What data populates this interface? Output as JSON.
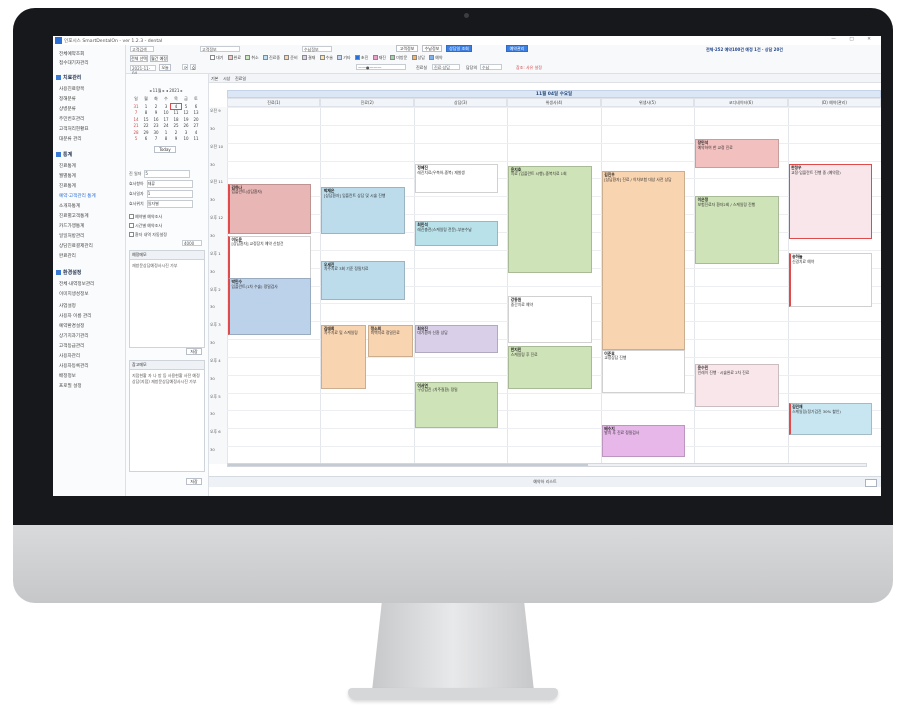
{
  "app": {
    "title": "인포시스 SmartDentalOn - ver 1.2.3 - dental",
    "window_buttons": "— □ ✕"
  },
  "nav": {
    "items_top": [
      "전체예약조회",
      "접수대기자관리"
    ],
    "section1": "치료관리",
    "section1_items": [
      "사용진료항목",
      "정해분류",
      "상병분류",
      "주민번호관리",
      "고객처리현황표",
      "대분류 관리"
    ],
    "section2": "통계",
    "section2_items": [
      "진료통계",
      "월별통계",
      "진료통계",
      "예약·고객관리 통계",
      "소개자통계",
      "진료별고객통계",
      "카드가맹통계",
      "일일처방관리",
      "상담진료결제관리",
      "완료관리"
    ],
    "section3": "환경설정",
    "section3_items": [
      "전체·내역정보관리",
      "이미지생성정보",
      "사업설정",
      "사용자 이름 관리",
      "예약환경설정",
      "상기치과기관리",
      "고객등급관리",
      "사용자관리",
      "사용자등록관리",
      "배정정보",
      "프로필 설정"
    ]
  },
  "toolbar": {
    "search_label": "고객검색",
    "tab_all": "전체 선택",
    "tab_week": "월간 예정",
    "date": "2021-11-04",
    "today_btn": "오늘",
    "btn_print": "고객정보",
    "btn_reg": "수납정보",
    "btn_consult": "상담일 조회",
    "btn_reserve": "예약관리",
    "legend": [
      "대기",
      "완료",
      "취소",
      "진료중",
      "준비",
      "결재",
      "수술",
      "기타",
      "초진",
      "재진",
      "미방문",
      "상담",
      "예약",
      "시술",
      "치료",
      "교정",
      "임플란트",
      "보철",
      "스케일링",
      "보존",
      "처방",
      "기타치료",
      "예정일"
    ],
    "legend_colors": [
      "#ffffff",
      "#f2c9c2",
      "#cfe8c4",
      "#bfe0ee",
      "#f7d8b0",
      "#d9cfe8",
      "#fbe4a8",
      "#c8d7f0"
    ],
    "counter": "전체·252 예약100건 예정 1건 · 상담 20건",
    "filter_label": "진료실",
    "filter_value": "진료·상담",
    "doctor_label": "담당의",
    "doctor_value": "수납",
    "note": "참조: 사유 설정"
  },
  "side": {
    "minical_head": "◂ 11월 ▸  ◂ 2021 ▸",
    "weekdays": [
      "일",
      "월",
      "화",
      "수",
      "목",
      "금",
      "토"
    ],
    "days": [
      "31",
      "1",
      "2",
      "3",
      "4",
      "5",
      "6",
      "7",
      "8",
      "9",
      "10",
      "11",
      "12",
      "13",
      "14",
      "15",
      "16",
      "17",
      "18",
      "19",
      "20",
      "21",
      "22",
      "23",
      "24",
      "25",
      "26",
      "27",
      "28",
      "29",
      "30",
      "1",
      "2",
      "3",
      "4",
      "5",
      "6",
      "7",
      "8",
      "9",
      "10",
      "11"
    ],
    "today_index": 4,
    "today_btn": "Today",
    "fields": [
      {
        "label": "진 일자",
        "value": "5"
      },
      {
        "label": "효사항아",
        "value": "재류"
      },
      {
        "label": "효사일자",
        "value": "1"
      },
      {
        "label": "효사위치",
        "value": "일자별"
      }
    ],
    "checks": [
      "예약별 예약조사",
      "시간별 예약조사",
      "환자 내역 자동설정"
    ],
    "count_value": "4000",
    "memo1_title": "예정메모",
    "memo1_body": "재방문상담예정사시진 가부",
    "save_btn": "저장",
    "memo2_title": "참고메모",
    "memo2_body": "지점현황 자 나 방 등 사용현황 사전 예정상담(지점) 재방문상담예정사시진 가부"
  },
  "calendar": {
    "tabs": [
      "기본",
      "시상",
      "진료일"
    ],
    "date_title": "11월 04일 수요일",
    "columns": [
      "진료(1)",
      "진료(2)",
      "상담(3)",
      "위생사(4)",
      "위생사(5)",
      "코디네이터(6)",
      "(D) 예약(관리)"
    ],
    "time_labels": [
      "오전 9",
      "30",
      "오전 10",
      "30",
      "오전 11",
      "30",
      "오후 12",
      "30",
      "오후 1",
      "30",
      "오후 2",
      "30",
      "오후 3",
      "30",
      "오후 4",
      "30",
      "오후 5",
      "30",
      "오후 6",
      "30"
    ],
    "events": [
      {
        "title": "김하나",
        "body": "임플란트(상담환자)"
      },
      {
        "title": "박재은",
        "body": "[상담환자] 임플란트 상담 및 시술 진행"
      },
      {
        "title": "정혜진",
        "body": "레진치료(우측하-중복) 재발생"
      },
      {
        "title": "최민석",
        "body": "레진충전(스케일링 전문)-부분수납"
      },
      {
        "title": "윤지호",
        "body": "치료 (임플란트 시행)-중복치료 1회"
      },
      {
        "title": "김진우",
        "body": "[상담환자] 진료 / 이차보험 대상 사전 상담"
      },
      {
        "title": "장민석",
        "body": "예약하여 한 교정 진료"
      },
      {
        "title": "이은정",
        "body": "보험진료자 환자2회 / 스케일링 진행"
      },
      {
        "title": "한정우",
        "body": "교정·임플란트 진행 중 (예약함)"
      },
      {
        "title": "오세진",
        "body": "치주치료 3회 기준 정밀치료"
      },
      {
        "title": "이도윤",
        "body": "[상담환자] 교정장치 예약 신청건"
      },
      {
        "title": "박민수",
        "body": "임플란트(1차 수술) 정밀검사"
      },
      {
        "title": "김태희",
        "body": "치주치료 및 스케일링"
      },
      {
        "title": "정소희",
        "body": "미백치료 정밀진료"
      },
      {
        "title": "최유진",
        "body": "대기환자 신환 상담"
      },
      {
        "title": "이서연",
        "body": "구강검진 (치주질환) 정밀"
      },
      {
        "title": "강동원",
        "body": "중간치료 예약"
      },
      {
        "title": "한지민",
        "body": "스케일링 후 진료"
      },
      {
        "title": "이준호",
        "body": "교정상담 진행"
      },
      {
        "title": "송하늘",
        "body": "신경치료 예약"
      },
      {
        "title": "윤수민",
        "body": "인레이 진행 · 시술완료 2차 진료"
      },
      {
        "title": "배수지",
        "body": "발치 후 진료 정밀검사"
      },
      {
        "title": "김민재",
        "body": "스케일링(정기검진 30% 할인)"
      }
    ],
    "footer_label": "예약하 리스트"
  }
}
